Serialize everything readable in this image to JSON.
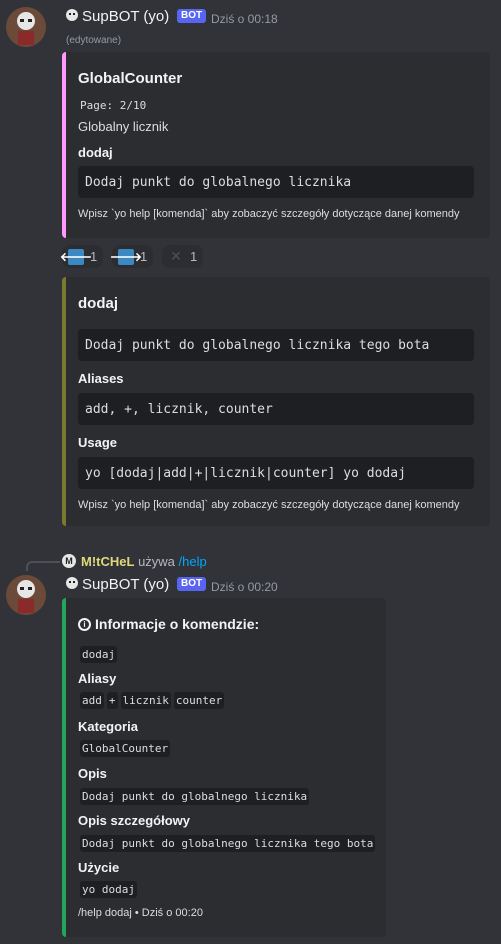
{
  "message1": {
    "username": "SupBOT (yo)",
    "bot_tag": "BOT",
    "timestamp": "Dziś o 00:18",
    "edited": "(edytowane)",
    "embed": {
      "accent_color": "#ff99ff",
      "title": "GlobalCounter",
      "page": "Page: 2/10",
      "description": "Globalny licznik",
      "field_name": "dodaj",
      "field_value": "Dodaj punkt do globalnego licznika",
      "footer": "Wpisz `yo help [komenda]` aby zobaczyć szczegóły dotyczące danej komendy"
    },
    "reactions": [
      {
        "emoji": "arrow-left-icon",
        "count": "1"
      },
      {
        "emoji": "arrow-right-icon",
        "count": "1"
      },
      {
        "emoji": "close-icon",
        "count": "1"
      }
    ],
    "embed2": {
      "accent_color": "#7a7a2e",
      "title": "dodaj",
      "description": "Dodaj punkt do globalnego licznika tego bota",
      "aliases_name": "Aliases",
      "aliases_value": "add, +, licznik, counter",
      "usage_name": "Usage",
      "usage_value": "yo [dodaj|add|+|licznik|counter] yo dodaj",
      "footer": "Wpisz `yo help [komenda]` aby zobaczyć szczegóły dotyczące danej komendy"
    }
  },
  "reply": {
    "username": "M!tCHeL",
    "action": "używa",
    "command": "/help",
    "username_color": "#e0d97a",
    "command_color": "#00a8fc"
  },
  "message2": {
    "username": "SupBOT (yo)",
    "bot_tag": "BOT",
    "timestamp": "Dziś o 00:20",
    "embed": {
      "accent_color": "#23a55a",
      "title": "Informacje o komendzie:",
      "title_icon": "info-icon",
      "command": "dodaj",
      "aliases_name": "Aliasy",
      "aliases": [
        "add",
        "+",
        "licznik",
        "counter"
      ],
      "category_name": "Kategoria",
      "category_value": "GlobalCounter",
      "desc_name": "Opis",
      "desc_value": "Dodaj punkt do globalnego licznika",
      "detail_name": "Opis szczegółowy",
      "detail_value": "Dodaj punkt do globalnego licznika tego bota",
      "usage_name": "Użycie",
      "usage_value": "yo dodaj",
      "footer": "/help dodaj • Dziś o 00:20"
    }
  }
}
